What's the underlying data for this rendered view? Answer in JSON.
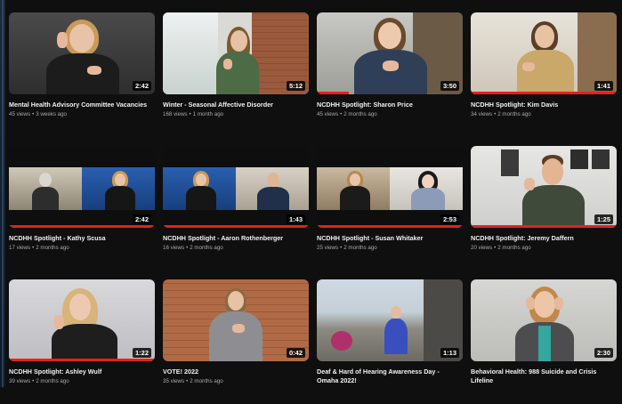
{
  "videos": [
    {
      "title": "Mental Health Advisory Committee Vacancies",
      "views": "45 views",
      "age": "3 weeks ago",
      "duration": "2:42",
      "progress": 0
    },
    {
      "title": "Winter - Seasonal Affective Disorder",
      "views": "168 views",
      "age": "1 month ago",
      "duration": "5:12",
      "progress": 0
    },
    {
      "title": "NCDHH Spotlight: Sharon Price",
      "views": "45 views",
      "age": "2 months ago",
      "duration": "3:50",
      "progress": 22
    },
    {
      "title": "NCDHH Spotlight: Kim Davis",
      "views": "34 views",
      "age": "2 months ago",
      "duration": "1:41",
      "progress": 100
    },
    {
      "title": "NCDHH Spotlight - Kathy Scusa",
      "views": "17 views",
      "age": "2 months ago",
      "duration": "2:42",
      "progress": 100
    },
    {
      "title": "NCDHH Spotlight - Aaron Rothenberger",
      "views": "16 views",
      "age": "2 months ago",
      "duration": "1:43",
      "progress": 100
    },
    {
      "title": "NCDHH Spotlight - Susan Whitaker",
      "views": "25 views",
      "age": "2 months ago",
      "duration": "2:53",
      "progress": 100
    },
    {
      "title": "NCDHH Spotlight: Jeremy Daffern",
      "views": "20 views",
      "age": "2 months ago",
      "duration": "1:25",
      "progress": 100
    },
    {
      "title": "NCDHH Spotlight: Ashley Wulf",
      "views": "39 views",
      "age": "2 months ago",
      "duration": "1:22",
      "progress": 100
    },
    {
      "title": "VOTE! 2022",
      "views": "35 views",
      "age": "2 months ago",
      "duration": "0:42",
      "progress": 0
    },
    {
      "title": "Deaf & Hard of Hearing Awareness Day - Omaha 2022!",
      "views": "",
      "age": "",
      "duration": "1:13",
      "progress": 0
    },
    {
      "title": "Behavioral Health: 988 Suicide and Crisis Lifeline",
      "views": "",
      "age": "",
      "duration": "2:30",
      "progress": 0
    }
  ],
  "meta_separator": "•",
  "colors": {
    "background": "#0f0f0f",
    "progress": "#e62117",
    "meta": "#aaaaaa"
  }
}
